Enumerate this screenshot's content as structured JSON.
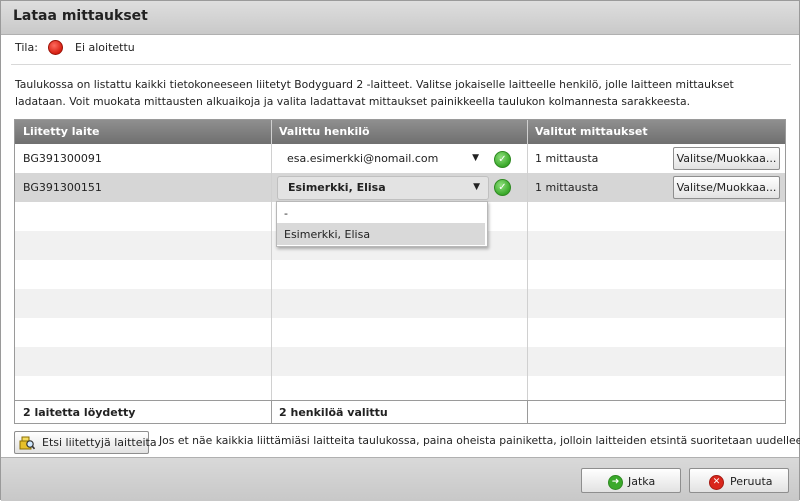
{
  "dialog": {
    "title": "Lataa mittaukset"
  },
  "status": {
    "label": "Tila:",
    "value": "Ei aloitettu",
    "color": "#e0281a"
  },
  "description": "Taulukossa on listattu kaikki tietokoneeseen liitetyt Bodyguard 2 -laitteet. Valitse jokaiselle laitteelle henkilö, jolle laitteen mittaukset ladataan. Voit muokata mittausten alkuaikoja ja valita ladattavat mittaukset painikkeella taulukon kolmannesta sarakkeesta.",
  "table": {
    "headers": [
      "Liitetty laite",
      "Valittu henkilö",
      "Valitut mittaukset"
    ],
    "rows": [
      {
        "device": "BG391300091",
        "person": "esa.esimerkki@nomail.com",
        "measurements": "1 mittausta",
        "button": "Valitse/Muokkaa..."
      },
      {
        "device": "BG391300151",
        "person": "Esimerkki, Elisa",
        "measurements": "1 mittausta",
        "button": "Valitse/Muokkaa..."
      }
    ],
    "dropdown_options": [
      "-",
      "Esimerkki, Elisa"
    ],
    "footer": {
      "devices_found": "2 laitetta löydetty",
      "persons_selected": "2 henkilöä valittu"
    }
  },
  "search": {
    "button_label": "Etsi liitettyjä laitteita",
    "hint": "Jos et näe kaikkia liittämiäsi laitteita taulukossa, paina oheista painiketta, jolloin laitteiden etsintä suoritetaan uudelleen."
  },
  "actions": {
    "continue_label": "Jatka",
    "cancel_label": "Peruuta",
    "continue_color": "#3aa92a",
    "cancel_color": "#d9261c"
  }
}
